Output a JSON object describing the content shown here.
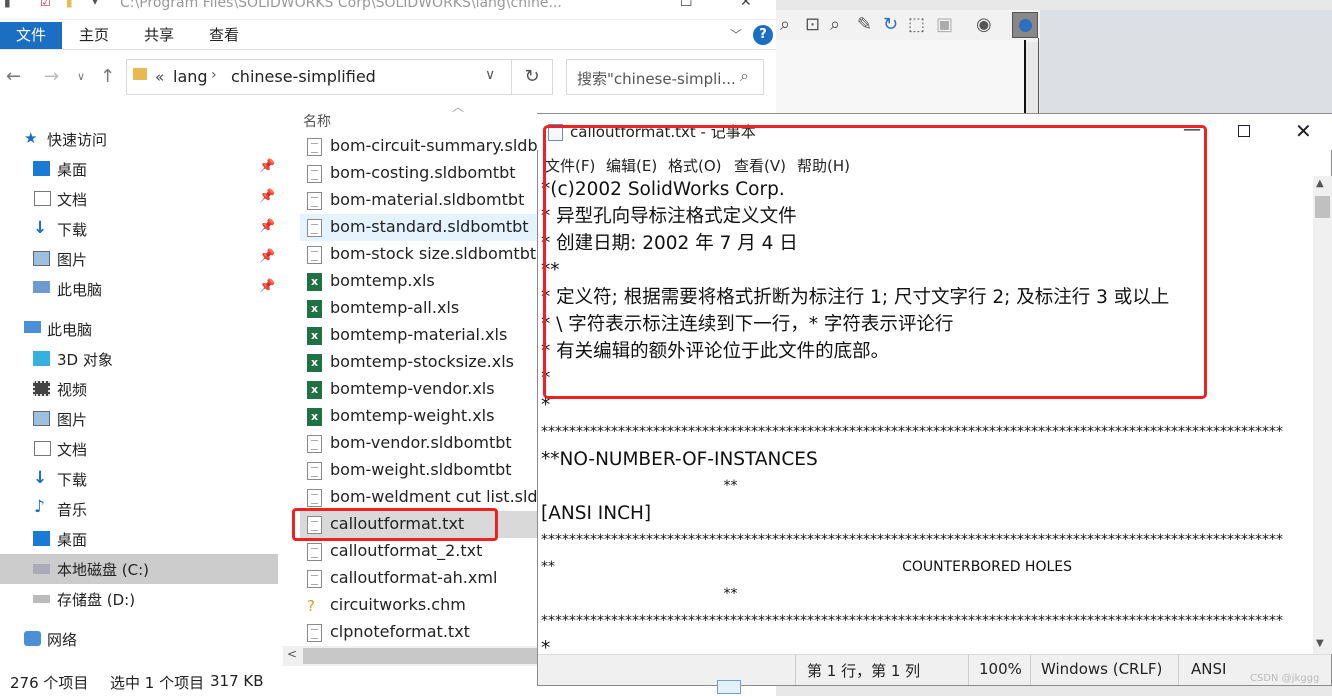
{
  "explorer": {
    "title": "C:\\Program Files\\SOLIDWORKS Corp\\SOLIDWORKS\\lang\\chine...",
    "ribbon_tabs": [
      "文件",
      "主页",
      "共享",
      "查看"
    ],
    "help_label": "?",
    "address": {
      "crumb_sep": "«",
      "crumbs": [
        "lang",
        "chinese-simplified"
      ],
      "search_placeholder": "搜索\"chinese-simpli..."
    },
    "sidebar": [
      {
        "label": "快速访问",
        "icon": "star-icon",
        "pinned": false
      },
      {
        "label": "桌面",
        "icon": "desktop-icon",
        "pinned": true
      },
      {
        "label": "文档",
        "icon": "documents-icon",
        "pinned": true
      },
      {
        "label": "下载",
        "icon": "download-icon",
        "pinned": true
      },
      {
        "label": "图片",
        "icon": "pictures-icon",
        "pinned": true
      },
      {
        "label": "此电脑",
        "icon": "this-pc-icon",
        "pinned": true
      },
      {
        "label": "此电脑",
        "icon": "computer-icon",
        "pinned": false
      },
      {
        "label": "3D 对象",
        "icon": "3d-objects-icon",
        "pinned": false
      },
      {
        "label": "视频",
        "icon": "videos-icon",
        "pinned": false
      },
      {
        "label": "图片",
        "icon": "pictures-icon",
        "pinned": false
      },
      {
        "label": "文档",
        "icon": "documents-icon",
        "pinned": false
      },
      {
        "label": "下载",
        "icon": "download-icon",
        "pinned": false
      },
      {
        "label": "音乐",
        "icon": "music-icon",
        "pinned": false
      },
      {
        "label": "桌面",
        "icon": "desktop-icon",
        "pinned": false
      },
      {
        "label": "本地磁盘 (C:)",
        "icon": "local-disk-icon",
        "pinned": false
      },
      {
        "label": "存储盘 (D:)",
        "icon": "storage-disk-icon",
        "pinned": false
      },
      {
        "label": "网络",
        "icon": "network-icon",
        "pinned": false
      }
    ],
    "column_header": "名称",
    "files": [
      {
        "name": "bom-circuit-summary.sldbomtbt",
        "type": "txt"
      },
      {
        "name": "bom-costing.sldbomtbt",
        "type": "txt"
      },
      {
        "name": "bom-material.sldbomtbt",
        "type": "txt"
      },
      {
        "name": "bom-standard.sldbomtbt",
        "type": "txt"
      },
      {
        "name": "bom-stock size.sldbomtbt",
        "type": "txt"
      },
      {
        "name": "bomtemp.xls",
        "type": "xls"
      },
      {
        "name": "bomtemp-all.xls",
        "type": "xls"
      },
      {
        "name": "bomtemp-material.xls",
        "type": "xls"
      },
      {
        "name": "bomtemp-stocksize.xls",
        "type": "xls"
      },
      {
        "name": "bomtemp-vendor.xls",
        "type": "xls"
      },
      {
        "name": "bomtemp-weight.xls",
        "type": "xls"
      },
      {
        "name": "bom-vendor.sldbomtbt",
        "type": "txt"
      },
      {
        "name": "bom-weight.sldbomtbt",
        "type": "txt"
      },
      {
        "name": "bom-weldment cut list.sldbomtbt",
        "type": "txt"
      },
      {
        "name": "calloutformat.txt",
        "type": "txt"
      },
      {
        "name": "calloutformat_2.txt",
        "type": "txt"
      },
      {
        "name": "calloutformat-ah.xml",
        "type": "txt"
      },
      {
        "name": "circuitworks.chm",
        "type": "chm"
      },
      {
        "name": "clpnoteformat.txt",
        "type": "txt"
      }
    ],
    "status": {
      "count": "276 个项目",
      "selection": "选中 1 个项目",
      "size": "317 KB"
    }
  },
  "notepad": {
    "title": "calloutformat.txt - 记事本",
    "menus": [
      "文件(F)",
      "编辑(E)",
      "格式(O)",
      "查看(V)",
      "帮助(H)"
    ],
    "lines": [
      "*(c)2002 SolidWorks Corp.",
      "* 异型孔向导标注格式定义文件",
      "* 创建日期: 2002 年 7 月 4 日",
      "**",
      "* 定义符; 根据需要将格式折断为标注行 1; 尺寸文字行 2; 及标注行 3 或以上",
      "* \\ 字符表示标注连续到下一行，* 字符表示评论行",
      "* 有关编辑的额外评论位于此文件的底部。",
      "*",
      "*",
      "**********************************************************************************************************",
      "**NO-NUMBER-OF-INSTANCES",
      "                                         **",
      "[ANSI INCH]",
      "**********************************************************************************************************",
      "**                                                                              COUNTERBORED HOLES",
      "                                         **",
      "**********************************************************************************************************",
      "*"
    ],
    "status": {
      "position": "第 1 行，第 1 列",
      "zoom": "100%",
      "eol": "Windows (CRLF)",
      "encoding": "ANSI"
    }
  },
  "watermark": "CSDN @jkggg",
  "colors": {
    "accent": "#1a6fc2",
    "highlight_red": "#ee2222"
  }
}
